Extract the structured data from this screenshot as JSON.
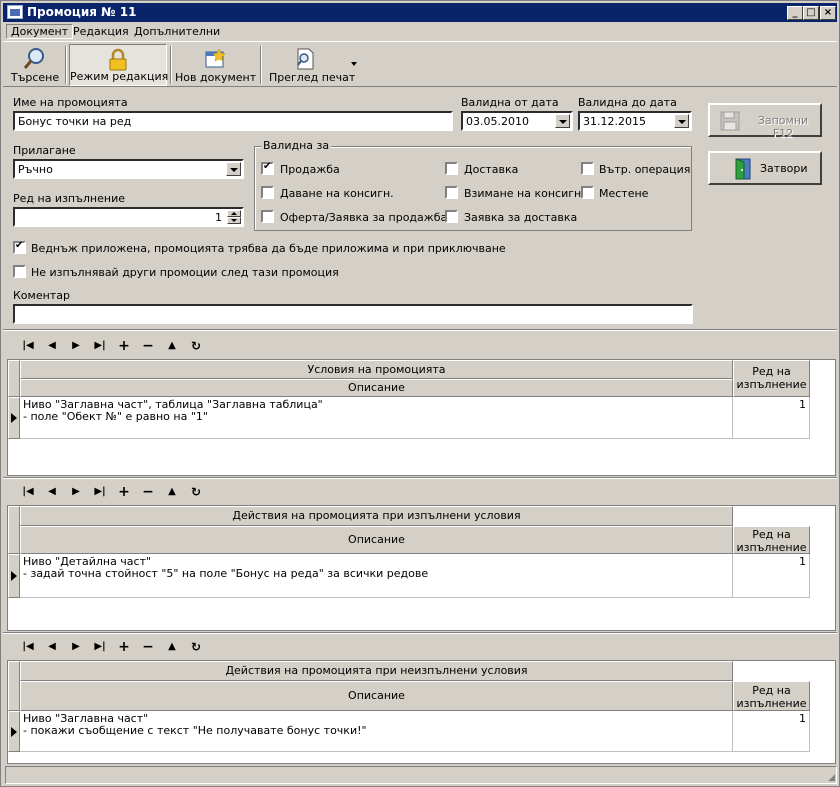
{
  "window": {
    "title": "Промоция № 11"
  },
  "menu": [
    "Документ",
    "Редакция",
    "Допълнителни"
  ],
  "toolbar": {
    "search": "Търсене",
    "edit_mode": "Режим редакция",
    "new_doc": "Нов документ",
    "print_preview": "Преглед печат"
  },
  "form": {
    "name_label": "Име на промоцията",
    "name_value": "Бонус точки на ред",
    "valid_from_label": "Валидна от дата",
    "valid_from_value": "03.05.2010",
    "valid_to_label": "Валидна до дата",
    "valid_to_value": "31.12.2015",
    "apply_label": "Прилагане",
    "apply_value": "Ръчно",
    "order_label": "Ред на изпълнение",
    "order_value": "1",
    "valid_for_label": "Валидна за",
    "valid_for": {
      "sale": {
        "label": "Продажба",
        "checked": true
      },
      "delivery": {
        "label": "Доставка",
        "checked": false
      },
      "internal": {
        "label": "Вътр. операция",
        "checked": false
      },
      "consign_give": {
        "label": "Даване на консигн.",
        "checked": false
      },
      "consign_take": {
        "label": "Взимане на консигн.",
        "checked": false
      },
      "move": {
        "label": "Местене",
        "checked": false
      },
      "offer": {
        "label": "Оферта/Заявка за продажба",
        "checked": false
      },
      "delivery_request": {
        "label": "Заявка за доставка",
        "checked": false
      }
    },
    "once_applied": {
      "label": "Веднъж приложена, промоцията трябва да бъде приложима и при приключване",
      "checked": true
    },
    "no_other": {
      "label": "Не изпълнявай други промоции след тази промоция",
      "checked": false
    },
    "comment_label": "Коментар",
    "comment_value": ""
  },
  "buttons": {
    "save": "Запомни  F12",
    "close": "Затвори"
  },
  "grids": {
    "conditions": {
      "title": "Условия на промоцията",
      "col_desc": "Описание",
      "col_order": "Ред на\nизпълнение",
      "row_desc": "Ниво \"Заглавна част\", таблица \"Заглавна таблица\"\n- поле \"Обект №\" е равно на \"1\"",
      "row_order": "1"
    },
    "actions_met": {
      "title": "Действия на промоцията при изпълнени условия",
      "col_desc": "Описание",
      "col_order": "Ред на\nизпълнение",
      "row_desc": "Ниво \"Детайлна част\"\n- задай точна стойност \"5\" на поле \"Бонус на реда\" за всички редове",
      "row_order": "1"
    },
    "actions_unmet": {
      "title": "Действия на промоцията при неизпълнени условия",
      "col_desc": "Описание",
      "col_order": "Ред на\nизпълнение",
      "row_desc": "Ниво \"Заглавна част\"\n- покажи съобщение с текст \"Не получавате бонус точки!\"",
      "row_order": "1"
    }
  },
  "nav_icons": [
    "first-icon",
    "prev-icon",
    "next-icon",
    "last-icon",
    "add-icon",
    "delete-icon",
    "up-icon",
    "refresh-icon"
  ],
  "colors": {
    "titlebar": "#0a246a",
    "face": "#d4d0c8"
  }
}
